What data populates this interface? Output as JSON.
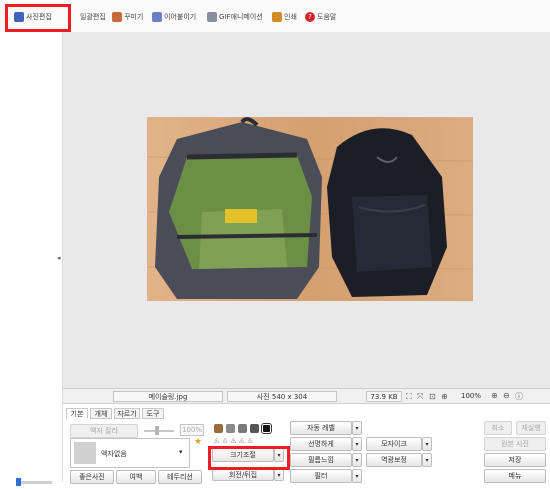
{
  "tabs": [
    {
      "label": "사진편집",
      "icon": "photo-edit-icon"
    },
    {
      "label": "일괄편집",
      "icon": "batch-edit-icon"
    },
    {
      "label": "꾸미기",
      "icon": "decorate-icon"
    },
    {
      "label": "이어붙이기",
      "icon": "merge-icon"
    },
    {
      "label": "GIF애니메이션",
      "icon": "gif-icon"
    },
    {
      "label": "인쇄",
      "icon": "print-icon"
    },
    {
      "label": "도움말",
      "icon": "help-icon"
    }
  ],
  "status": {
    "filename": "메이슬링.jpg",
    "dimensions": "사진 540 x 304",
    "filesize": "73.9 KB",
    "zoom": "100%"
  },
  "panel": {
    "tabs": [
      "기본",
      "개체",
      "자르기",
      "도구"
    ],
    "frame_cut_label": "액자 잘라",
    "percent_value": "100%",
    "frame_select": "액자없음",
    "btn_recent_photo": "좋은사진",
    "btn_margin": "여백",
    "btn_border": "테두리선",
    "btn_auto_level": "자동 레벨",
    "btn_sharpen": "선명하게",
    "btn_resize": "크기조절",
    "btn_rotate": "회전/뒤집",
    "btn_soft": "필름느낌",
    "btn_filter": "필터",
    "btn_mosaic": "모자이크",
    "btn_backlight": "역광보정",
    "btn_cancel": "취소",
    "btn_redo": "재실행",
    "btn_original": "원본 사진",
    "btn_save": "저장",
    "btn_menu": "메뉴"
  },
  "colors": {
    "highlight": "#ee1c24",
    "canvas_bg": "#e9e9e9",
    "photo_floor": "#d8a677",
    "bag_green": "#6b8f45",
    "bag_gray": "#4a4d57",
    "bag_black": "#1c1e27"
  }
}
